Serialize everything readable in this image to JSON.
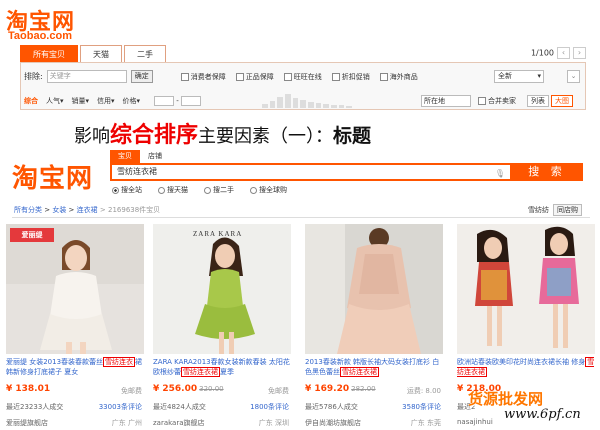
{
  "top": {
    "logo": "淘宝网",
    "logo_sub": "Taobao.com",
    "tabs": [
      "所有宝贝",
      "天猫",
      "二手"
    ],
    "pager": "1/100",
    "keyword_label": "排除:",
    "keyword_placeholder": "关键字",
    "confirm": "确定",
    "checks": [
      "消费者保障",
      "正品保障",
      "旺旺在线",
      "折扣促销",
      "海外商品"
    ],
    "select": "全新",
    "sorts": [
      "综合",
      "人气▾",
      "销量▾",
      "信用▾",
      "价格▾"
    ],
    "location": "所在地",
    "merge": "合并卖家",
    "views": [
      "列表",
      "大图"
    ]
  },
  "heading": {
    "pre": "影响",
    "red": "综合排序",
    "mid": "主要因素（一）：",
    "bold": "标题"
  },
  "search": {
    "logo": "淘宝网",
    "tabs": [
      "宝贝",
      "店铺"
    ],
    "query": "雪纺连衣裙",
    "button": "搜 索",
    "radios": [
      "搜全站",
      "搜天猫",
      "搜二手",
      "搜全球购"
    ],
    "crumbs": [
      "所有分类",
      "女装",
      "连衣裙"
    ],
    "count": "2169638件宝贝",
    "shop_label": "雪纺纺",
    "shop_button": "同店购"
  },
  "products": [
    {
      "badge": "爱丽缇",
      "title_a": "爱丽缇 女装2013春装春款蕾丝",
      "hl": "雪纺连衣",
      "title_b": "裙 韩新修身打底裙子 夏女",
      "price": "¥ 138.01",
      "old": "",
      "ship": "免邮费",
      "sold": "最近23233人成交",
      "comments": "33003条评论",
      "shop": "爱丽缇旗舰店",
      "loc": "广东 广州"
    },
    {
      "badge": "ZARA KARA",
      "title_a": "ZARA KARA2013春款女装新款春装 太阳花欧根纱蕾",
      "hl": "雪纺连衣裙",
      "title_b": "夏季",
      "price": "¥ 256.00",
      "old": "320.00",
      "ship": "免邮费",
      "sold": "最近4824人成交",
      "comments": "1800条评论",
      "shop": "zarakara旗舰店",
      "loc": "广东 深圳"
    },
    {
      "badge": "",
      "title_a": "2013春装新款 韩版长袖大码女装打底衫 白色黑色蕾丝",
      "hl": "雪纺连衣裙",
      "title_b": "",
      "price": "¥ 169.20",
      "old": "282.00",
      "ship": "运费: 8.00",
      "sold": "最近5786人成交",
      "comments": "3580条评论",
      "shop": "伊自尚潮坊旗舰店",
      "loc": "广东 东莞"
    },
    {
      "badge": "",
      "title_a": "欧洲站春装欧美印花时尚连衣裙长袖 修身",
      "hl": "雪纺连衣裙",
      "title_b": "",
      "price": "¥ 218.00",
      "old": "",
      "ship": "",
      "sold": "最近2",
      "comments": "",
      "shop": "nasajinhui",
      "loc": ""
    }
  ],
  "watermark": {
    "a": "货源批发网",
    "b": "www.6pf.cn"
  },
  "colors": {
    "accent": "#ff5500",
    "highlight": "#e00000",
    "link": "#3366cc"
  }
}
